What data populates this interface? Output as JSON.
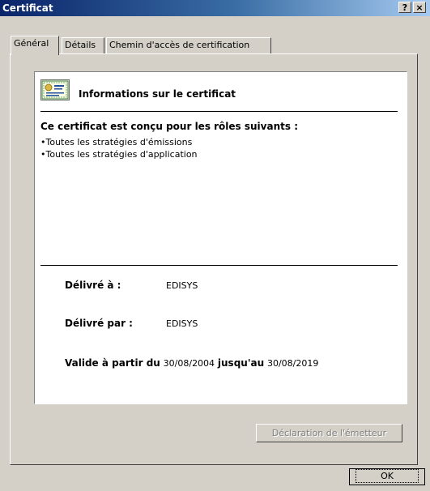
{
  "window": {
    "title": "Certificat",
    "help_label": "?",
    "close_label": "×"
  },
  "tabs": [
    {
      "label": "Général"
    },
    {
      "label": "Détails"
    },
    {
      "label": "Chemin d'accès de certification"
    }
  ],
  "info": {
    "heading": "Informations sur le certificat",
    "purpose_heading": "Ce certificat est conçu pour les rôles suivants :",
    "purposes": [
      "Toutes les stratégies d'émissions",
      "Toutes les stratégies d'application"
    ],
    "bullet": "•",
    "issued_to_label": "Délivré à :",
    "issued_to_value": "EDISYS",
    "issued_by_label": "Délivré par :",
    "issued_by_value": "EDISYS",
    "valid_from_label": "Valide à partir du",
    "valid_from_value": "30/08/2004",
    "valid_to_label": "jusqu'au",
    "valid_to_value": "30/08/2019"
  },
  "buttons": {
    "issuer_statement": "Déclaration de l'émetteur",
    "ok": "OK"
  },
  "icons": {
    "certificate": "certificate-icon"
  }
}
